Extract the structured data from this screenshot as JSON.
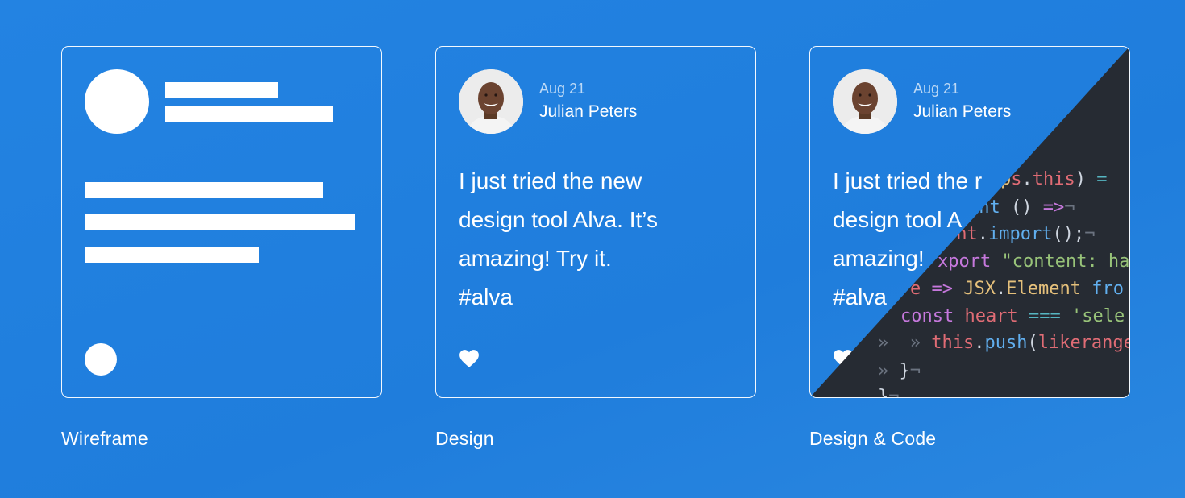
{
  "columns": [
    {
      "caption": "Wireframe"
    },
    {
      "caption": "Design"
    },
    {
      "caption": "Design & Code"
    }
  ],
  "post": {
    "date": "Aug 21",
    "author": "Julian Peters",
    "text": "I just tried the new\ndesign tool Alva. It’s\namazing! Try it.\n#alva",
    "partial_text": "I just tried the r\ndesign tool A\namazing!\n#alva"
  },
  "code_lines": [
    "ps.this) = ",
    "ent () =>¬",
    "ent.import();¬",
    "xport \"content: ha",
    "e => JSX.Element fro",
    "const heart === 'sele",
    "this.push(likerange",
    "}¬",
    "}¬"
  ],
  "colors": {
    "background": "#2383e2",
    "editor_background": "#262b33",
    "keyword": "#c678dd",
    "function": "#61afef",
    "string": "#98c379",
    "variable": "#e06c75"
  },
  "icons": {
    "heart": "heart-icon"
  }
}
